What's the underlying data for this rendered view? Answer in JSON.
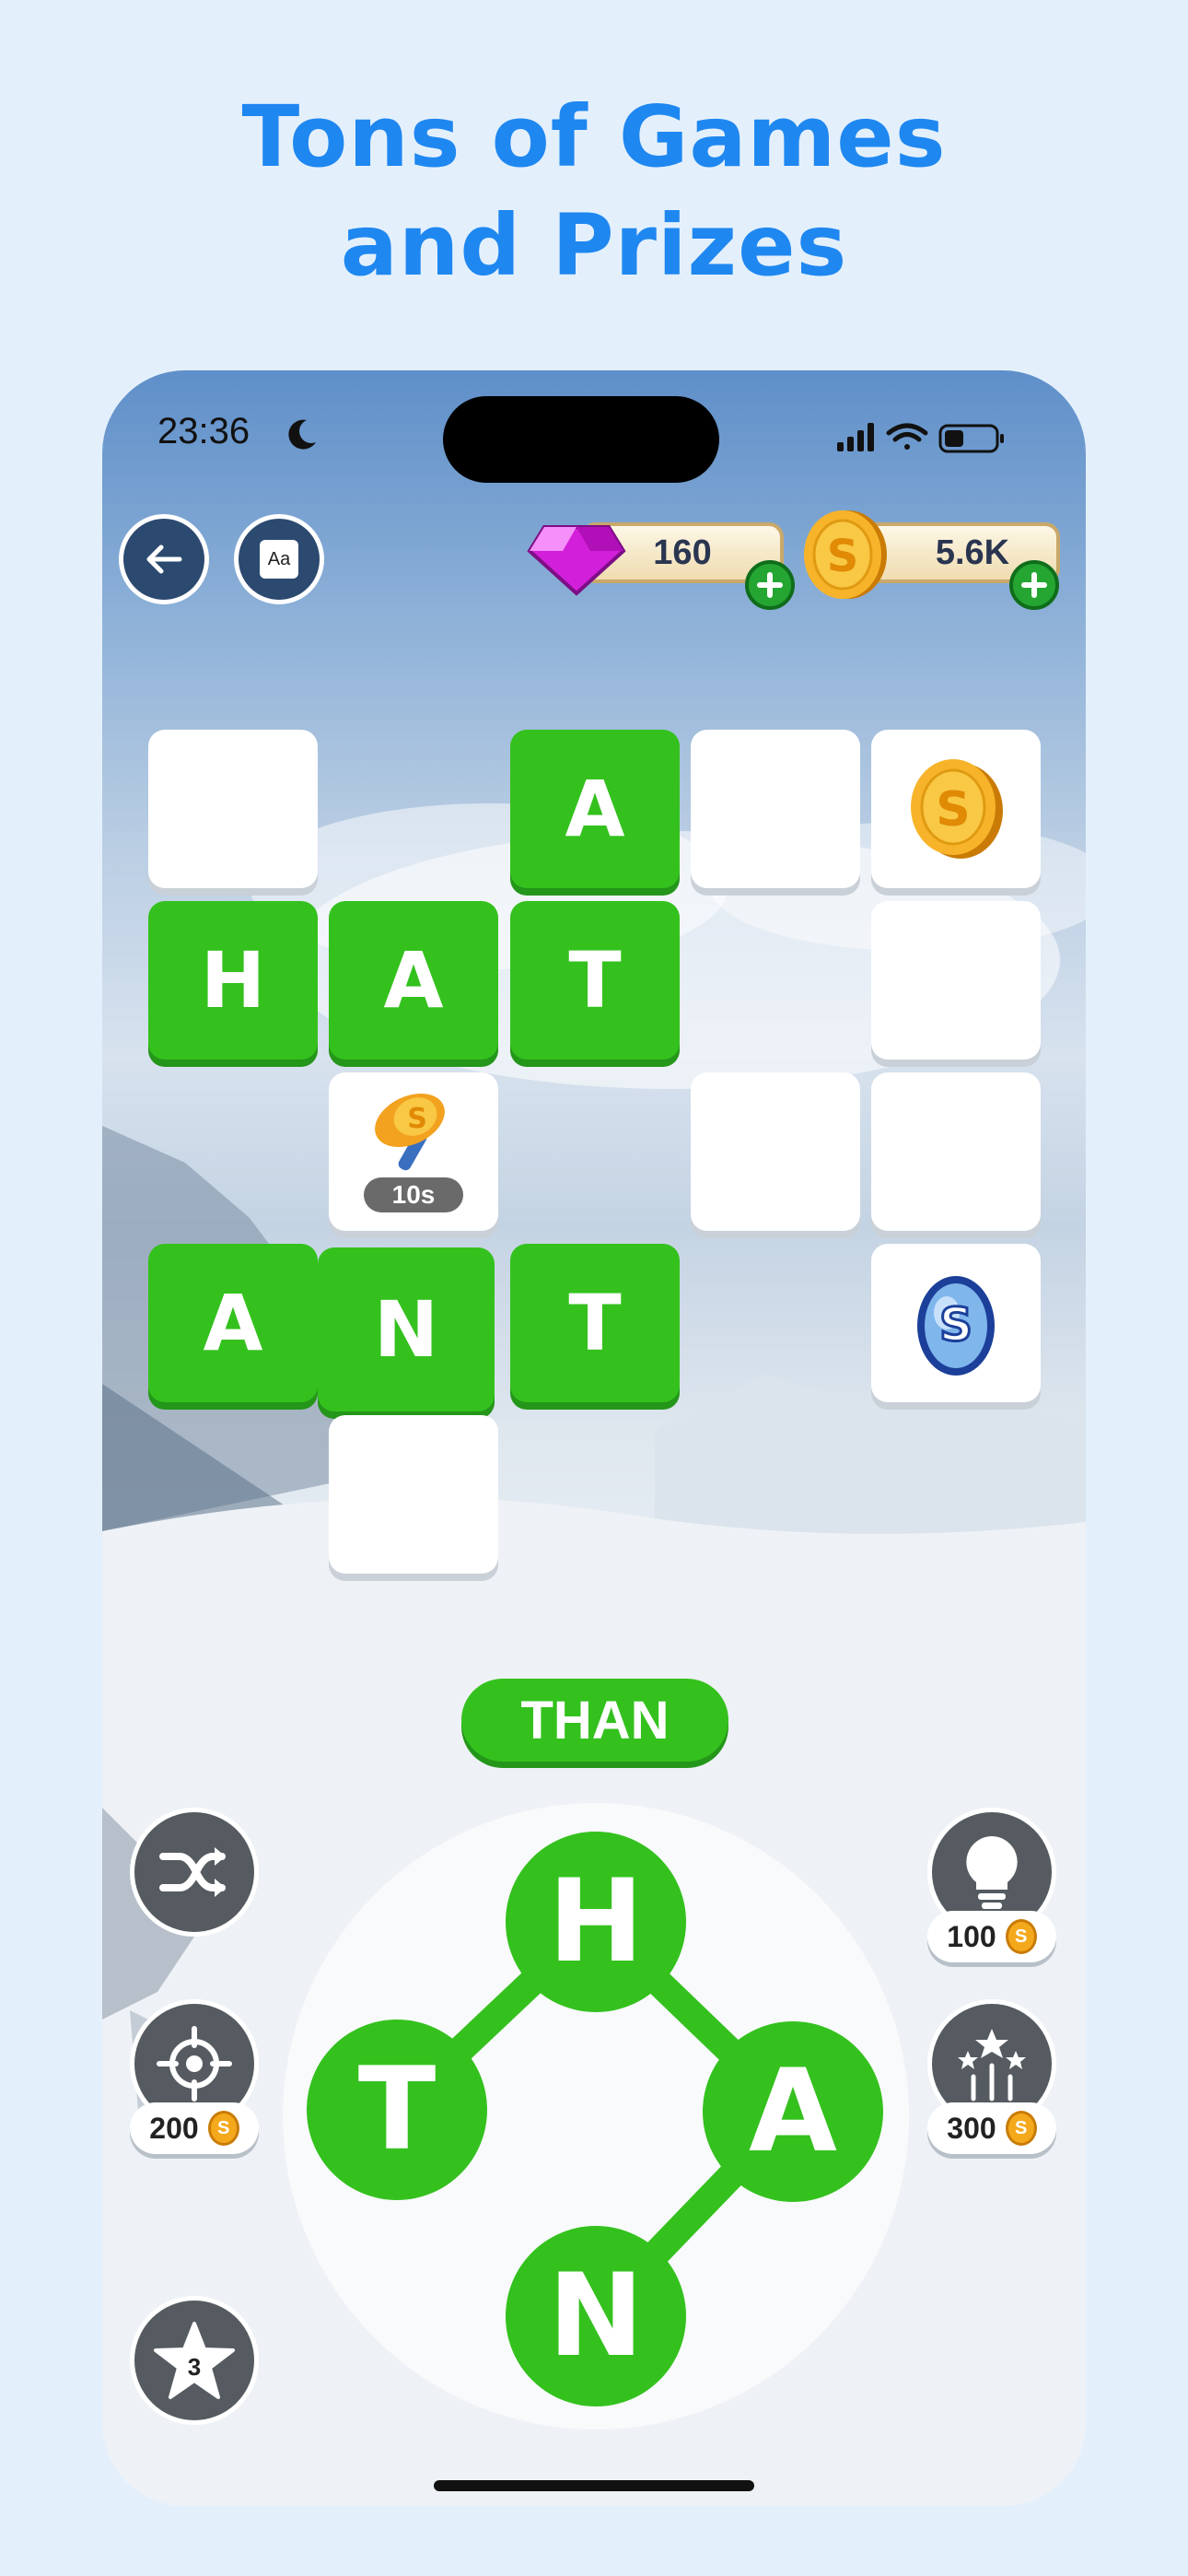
{
  "headline": {
    "line1": "Tons of Games",
    "line2": "and Prizes"
  },
  "status_bar": {
    "time": "23:36"
  },
  "topbar": {
    "back_icon": "arrow-left-icon",
    "font_icon_label": "Aa",
    "gems": {
      "value": "160",
      "icon": "gem-icon"
    },
    "coins": {
      "value": "5.6K",
      "icon": "coin-icon"
    }
  },
  "board": {
    "tiles": [
      {
        "id": "r0c0",
        "letter": ""
      },
      {
        "id": "r0c2",
        "letter": "A"
      },
      {
        "id": "r0c3",
        "letter": ""
      },
      {
        "id": "r0c4",
        "letter": "",
        "reward": "coin"
      },
      {
        "id": "r1c0",
        "letter": "H"
      },
      {
        "id": "r1c1",
        "letter": "A"
      },
      {
        "id": "r1c2",
        "letter": "T"
      },
      {
        "id": "r1c4",
        "letter": ""
      },
      {
        "id": "r2c1",
        "letter": "",
        "reward": "hammer",
        "timer": "10s"
      },
      {
        "id": "r2c3",
        "letter": ""
      },
      {
        "id": "r2c4",
        "letter": ""
      },
      {
        "id": "r3c0",
        "letter": "A"
      },
      {
        "id": "r3c1",
        "letter": "N"
      },
      {
        "id": "r3c2",
        "letter": "T"
      },
      {
        "id": "r3c4",
        "letter": "",
        "reward": "egg"
      },
      {
        "id": "r4c1",
        "letter": ""
      }
    ],
    "timer_label": "10s"
  },
  "current_word": "THAN",
  "wheel": {
    "letters": [
      "H",
      "A",
      "N",
      "T"
    ]
  },
  "tools": {
    "shuffle": {
      "icon": "shuffle-icon"
    },
    "target": {
      "icon": "crosshair-icon",
      "cost": "200"
    },
    "hint": {
      "icon": "lightbulb-icon",
      "cost": "100"
    },
    "fireworks": {
      "icon": "fireworks-icon",
      "cost": "300"
    },
    "star": {
      "icon": "star-icon",
      "count": "3"
    }
  },
  "colors": {
    "accent_green": "#34c11e",
    "headline_blue": "#1f87f0"
  }
}
